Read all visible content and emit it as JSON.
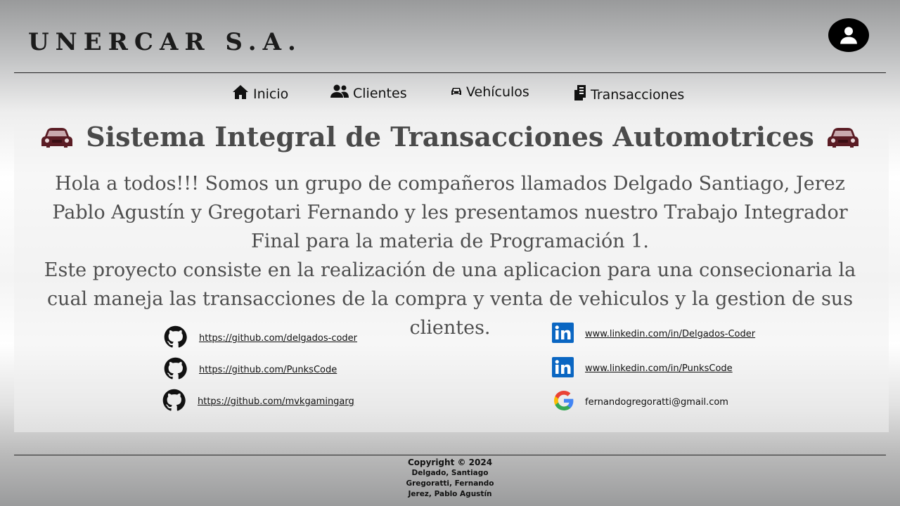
{
  "header": {
    "brand": "UNERCAR S.A.",
    "user_icon": "user-circle-icon"
  },
  "nav": [
    {
      "label": "Inicio",
      "icon": "home-icon"
    },
    {
      "label": "Clientes",
      "icon": "users-icon"
    },
    {
      "label": "Vehículos",
      "icon": "car-icon"
    },
    {
      "label": "Transacciones",
      "icon": "receipt-icon"
    }
  ],
  "main": {
    "title": "Sistema Integral de Transacciones Automotrices",
    "title_icon": "car-icon",
    "paragraph1": "Hola a todos!!! Somos un grupo de compañeros  llamados Delgado Santiago,  Jerez Pablo Agustín y Gregotari Fernando y les presentamos nuestro Trabajo Integrador Final para la materia de Programación 1.",
    "paragraph2": "Este proyecto consiste en la realización  de una aplicacion para una consecionaria la cual maneja las transacciones de la compra y venta de vehiculos y la gestion de sus clientes."
  },
  "contacts": {
    "github": [
      {
        "label": "https://github.com/delgados-coder",
        "icon": "github-icon"
      },
      {
        "label": "https://github.com/PunksCode",
        "icon": "github-icon"
      },
      {
        "label": "https://github.com/mvkgamingarg",
        "icon": "github-icon"
      }
    ],
    "other": [
      {
        "label": "www.linkedin.com/in/Delgados-Coder",
        "icon": "linkedin-icon"
      },
      {
        "label": "www.linkedin.com/in/PunksCode",
        "icon": "linkedin-icon"
      },
      {
        "label": "fernandogregoratti@gmail.com",
        "icon": "google-icon"
      }
    ]
  },
  "footer": {
    "copyright": "Copyright © 2024",
    "names": [
      "Delgado, Santiago",
      "Gregoratti, Fernando",
      "Jerez, Pablo Agustín"
    ]
  },
  "colors": {
    "car_icon": "#6b1f28",
    "linkedin": "#0a66c2"
  }
}
